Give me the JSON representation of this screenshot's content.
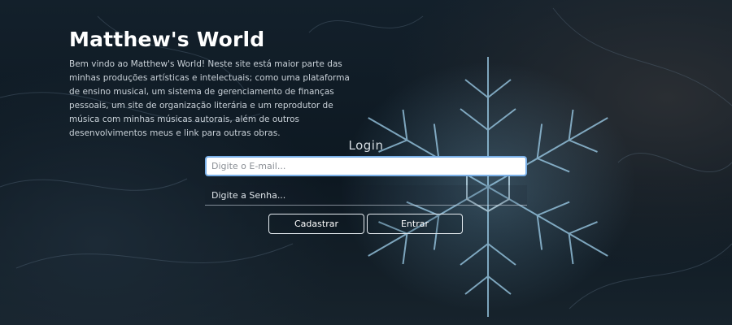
{
  "hero": {
    "title": "Matthew's World",
    "description": "Bem vindo ao Matthew's World! Neste site está maior parte das minhas produções artísticas e intelectuais; como uma plataforma de ensino musical, um sistema de gerenciamento de finanças pessoais, um site de organização literária e um reprodutor de música com minhas músicas autorais, além de outros desenvolvimentos meus e link para outras obras."
  },
  "login": {
    "title": "Login",
    "email_placeholder": "Digite o E-mail...",
    "password_placeholder": "Digite a Senha...",
    "register_label": "Cadastrar",
    "submit_label": "Entrar"
  }
}
